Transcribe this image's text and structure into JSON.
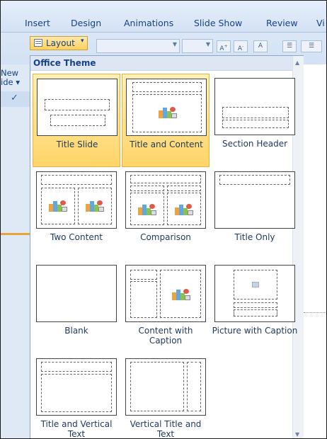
{
  "ribbon": {
    "tabs": [
      "Insert",
      "Design",
      "Animations",
      "Slide Show",
      "Review",
      "Vi"
    ],
    "layout_button": "Layout",
    "layout_chevron": "▾",
    "left_labels": [
      "New",
      "ide ▾"
    ]
  },
  "gallery": {
    "section_title": "Office Theme",
    "layouts": [
      {
        "label": "Title Slide"
      },
      {
        "label": "Title and Content"
      },
      {
        "label": "Section Header"
      },
      {
        "label": "Two Content"
      },
      {
        "label": "Comparison"
      },
      {
        "label": "Title Only"
      },
      {
        "label": "Blank"
      },
      {
        "label": "Content with Caption"
      },
      {
        "label": "Picture with Caption"
      },
      {
        "label": "Title and Vertical Text"
      },
      {
        "label": "Vertical Title and Text"
      }
    ]
  },
  "icons": {
    "layout": "layout-icon",
    "content_placeholder": "content-placeholder-icon",
    "scroll_up": "▲",
    "scroll_down": "▼"
  },
  "colors": {
    "selection": "#ffd468",
    "ribbon": "#d4e2f4",
    "accent": "#15428b"
  }
}
